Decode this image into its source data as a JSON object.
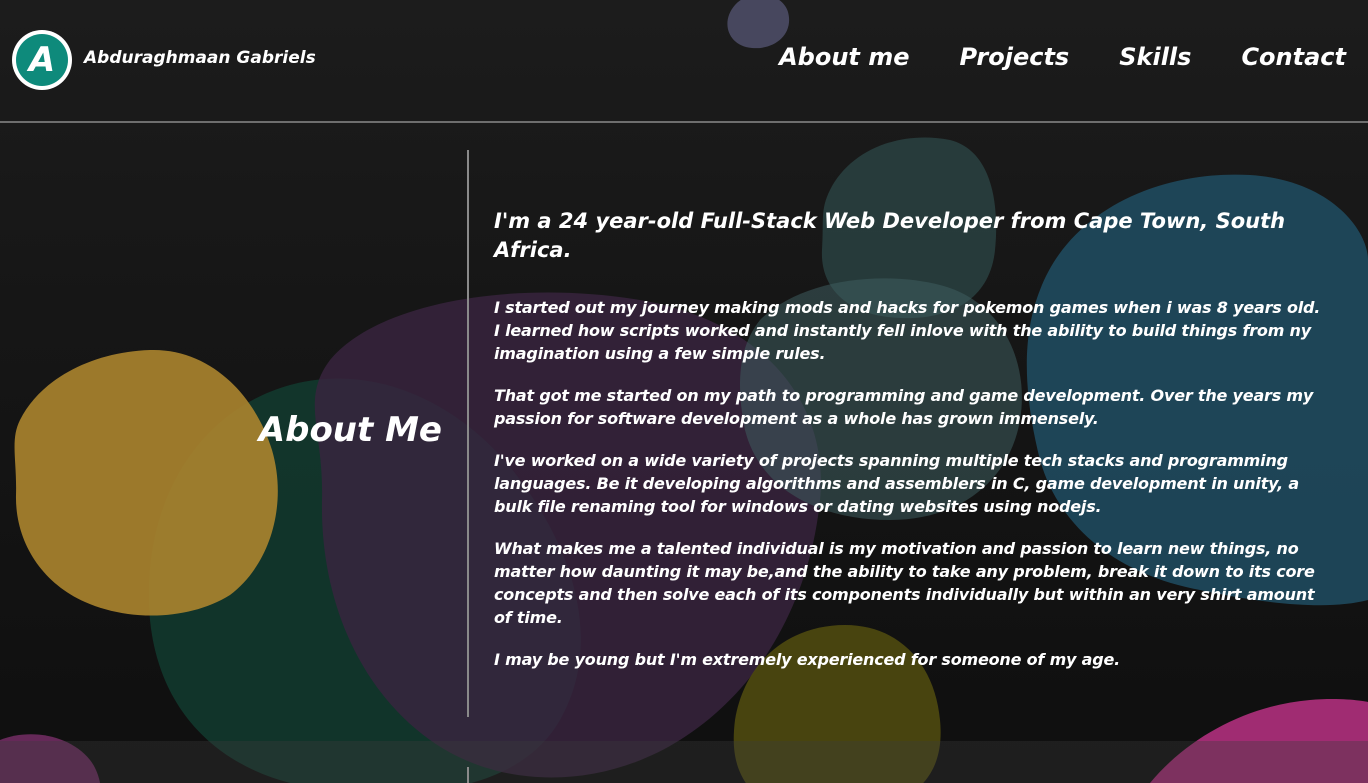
{
  "header": {
    "logo_letter": "A",
    "brand_name": "Abduraghmaan Gabriels",
    "nav": [
      {
        "label": "About me"
      },
      {
        "label": "Projects"
      },
      {
        "label": "Skills"
      },
      {
        "label": "Contact"
      }
    ]
  },
  "about": {
    "title": "About Me",
    "headline": "I'm a 24 year-old Full-Stack Web Developer from Cape Town, South Africa.",
    "paragraphs": [
      "I started out my journey making mods and hacks for pokemon games when i was 8 years old. I learned how scripts worked and instantly fell inlove with the ability to build things from ny imagination using a few simple rules.",
      "That got me started on my path to programming and game development. Over the years my passion for software development as a whole has grown immensely.",
      "I've worked on a wide variety of projects spanning multiple tech stacks and programming languages. Be it developing algorithms and assemblers in C, game development in unity, a bulk file renaming tool for windows or dating websites using nodejs.",
      "What makes me a talented individual is my motivation and passion to learn new things, no matter how daunting it may be,and the ability to take any problem, break it down to its core concepts and then solve each of its components individually but within an very shirt amount of time.",
      "I may be young but I'm extremely experienced for someone of my age."
    ]
  },
  "colors": {
    "accent": "#0e8a7b",
    "blob_gold": "#a8822e",
    "blob_green": "#12382d",
    "blob_purple": "#3a2440",
    "blob_blue": "#1f4a5e",
    "blob_teal": "#2d4a4a",
    "blob_olive": "#4f4a10",
    "blob_magenta": "#b0307d",
    "blob_slate": "#4a4a62"
  }
}
